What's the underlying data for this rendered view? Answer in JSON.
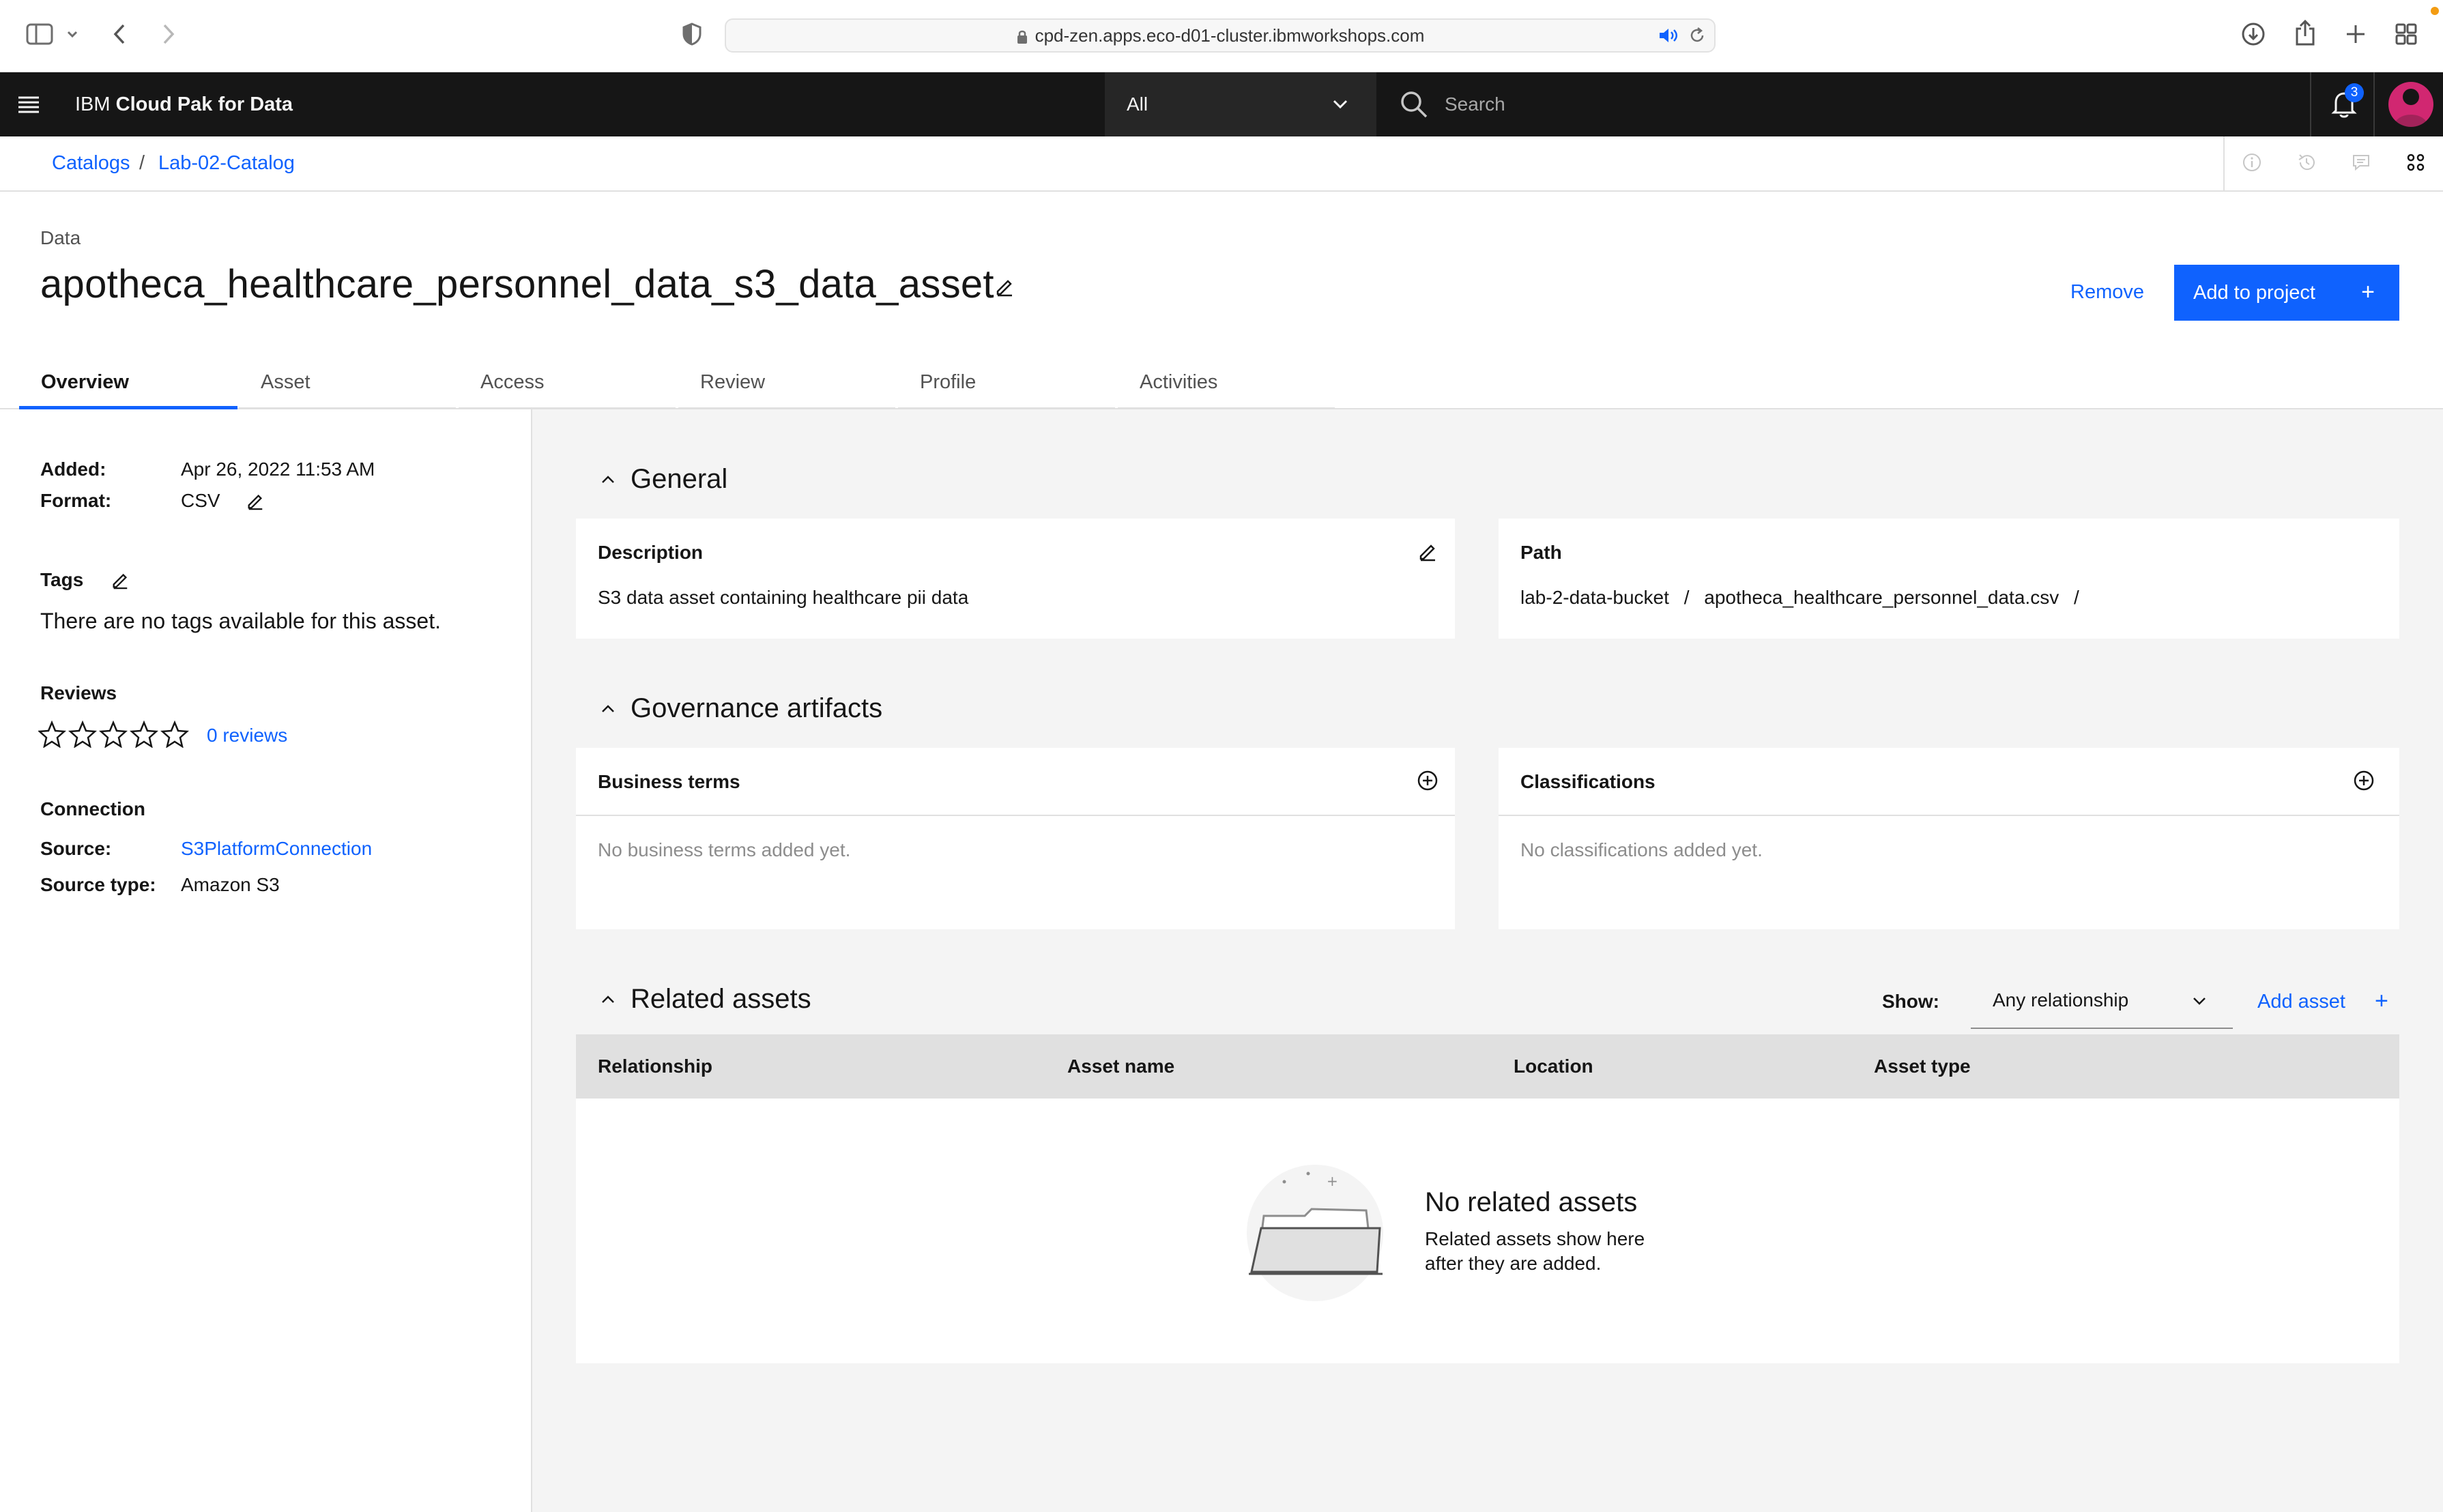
{
  "browser": {
    "url": "cpd-zen.apps.eco-d01-cluster.ibmworkshops.com"
  },
  "header": {
    "brand_prefix": "IBM",
    "brand_name": "Cloud Pak for Data",
    "scope_label": "All",
    "search_placeholder": "Search",
    "notification_count": "3"
  },
  "breadcrumb": {
    "items": [
      "Catalogs",
      "Lab-02-Catalog"
    ],
    "separator": "/"
  },
  "asset": {
    "kind": "Data",
    "title": "apotheca_healthcare_personnel_data_s3_data_asset",
    "remove_label": "Remove",
    "add_to_project_label": "Add to project"
  },
  "tabs": [
    "Overview",
    "Asset",
    "Access",
    "Review",
    "Profile",
    "Activities"
  ],
  "details": {
    "added_label": "Added:",
    "added_value": "Apr 26, 2022 11:53 AM",
    "format_label": "Format:",
    "format_value": "CSV",
    "tags_label": "Tags",
    "tags_empty": "There are no tags available for this asset.",
    "reviews_label": "Reviews",
    "reviews_link": "0 reviews",
    "rating_stars": 0,
    "connection_label": "Connection",
    "source_label": "Source:",
    "source_value": "S3PlatformConnection",
    "source_type_label": "Source type:",
    "source_type_value": "Amazon S3"
  },
  "general": {
    "heading": "General",
    "description_title": "Description",
    "description_text": "S3 data asset containing healthcare pii data",
    "path_title": "Path",
    "path_bucket": "lab-2-data-bucket",
    "path_file": "apotheca_healthcare_personnel_data.csv",
    "path_sep": "/"
  },
  "governance": {
    "heading": "Governance artifacts",
    "business_terms_title": "Business terms",
    "business_terms_empty": "No business terms added yet.",
    "classifications_title": "Classifications",
    "classifications_empty": "No classifications added yet."
  },
  "related": {
    "heading": "Related assets",
    "show_label": "Show:",
    "show_value": "Any relationship",
    "add_asset_label": "Add asset",
    "columns": [
      "Relationship",
      "Asset name",
      "Location",
      "Asset type"
    ],
    "empty_title": "No related assets",
    "empty_line1": "Related assets show here",
    "empty_line2": "after they are added."
  },
  "colors": {
    "accent": "#0f62fe",
    "header_bg": "#161616",
    "main_bg": "#f4f4f4"
  }
}
